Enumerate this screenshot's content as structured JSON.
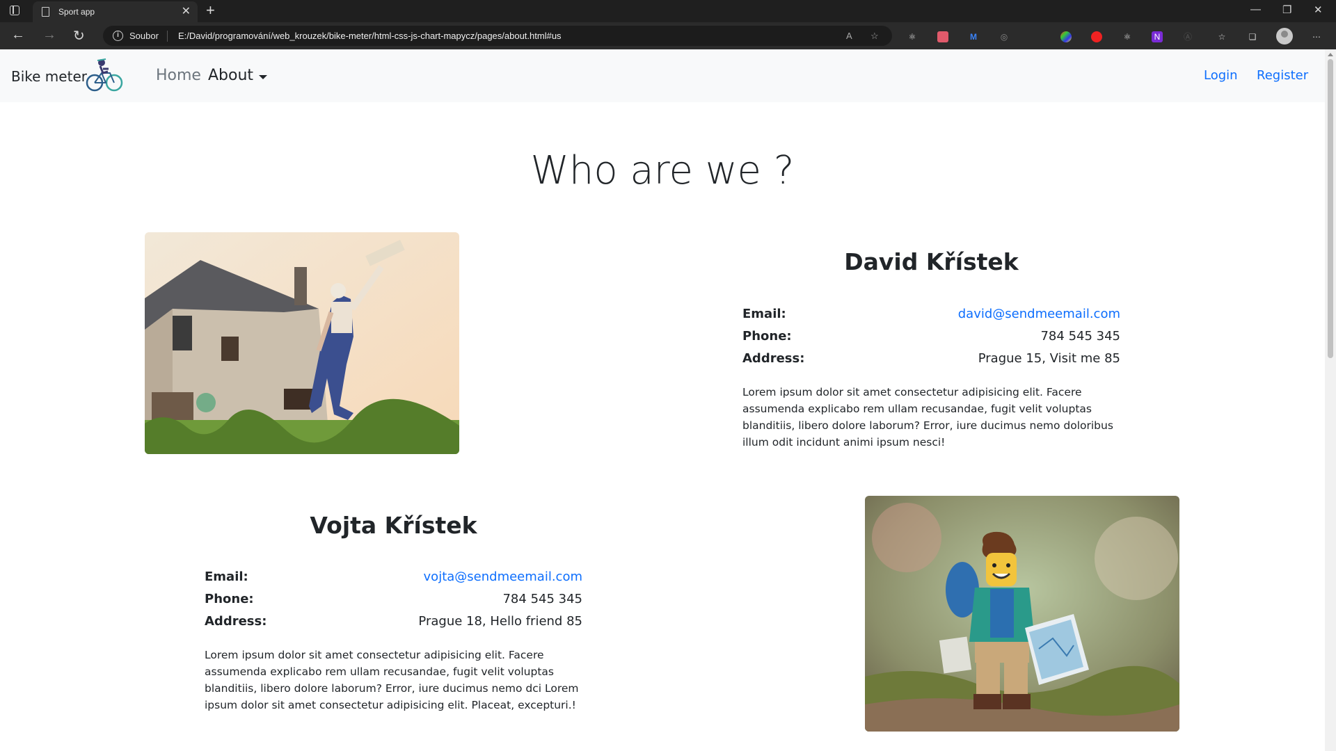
{
  "browser": {
    "tab_title": "Sport app",
    "url_scheme_label": "Soubor",
    "url": "E:/David/programování/web_krouzek/bike-meter/html-css-js-chart-mapycz/pages/about.html#us"
  },
  "navbar": {
    "brand": "Bike meter",
    "home": "Home",
    "about": "About",
    "login": "Login",
    "register": "Register"
  },
  "page": {
    "title": "Who are we ?"
  },
  "people": [
    {
      "name": "David Křístek",
      "email_label": "Email:",
      "email": "david@sendmeemail.com",
      "phone_label": "Phone:",
      "phone": "784 545 345",
      "address_label": "Address:",
      "address": "Prague 15, Visit me 85",
      "bio": "Lorem ipsum dolor sit amet consectetur adipisicing elit. Facere assumenda explicabo rem ullam recusandae, fugit velit voluptas blanditiis, libero dolore laborum? Error, iure ducimus nemo doloribus illum odit incidunt animi ipsum nesci!"
    },
    {
      "name": "Vojta Křístek",
      "email_label": "Email:",
      "email": "vojta@sendmeemail.com",
      "phone_label": "Phone:",
      "phone": "784 545 345",
      "address_label": "Address:",
      "address": "Prague 18, Hello friend 85",
      "bio": "Lorem ipsum dolor sit amet consectetur adipisicing elit. Facere assumenda explicabo rem ullam recusandae, fugit velit voluptas blanditiis, libero dolore laborum? Error, iure ducimus nemo dci Lorem ipsum dolor sit amet consectetur adipisicing elit. Placeat, excepturi.!"
    }
  ],
  "colors": {
    "link": "#0d6efd",
    "navbar_bg": "#f8f9fa",
    "text": "#212529"
  }
}
